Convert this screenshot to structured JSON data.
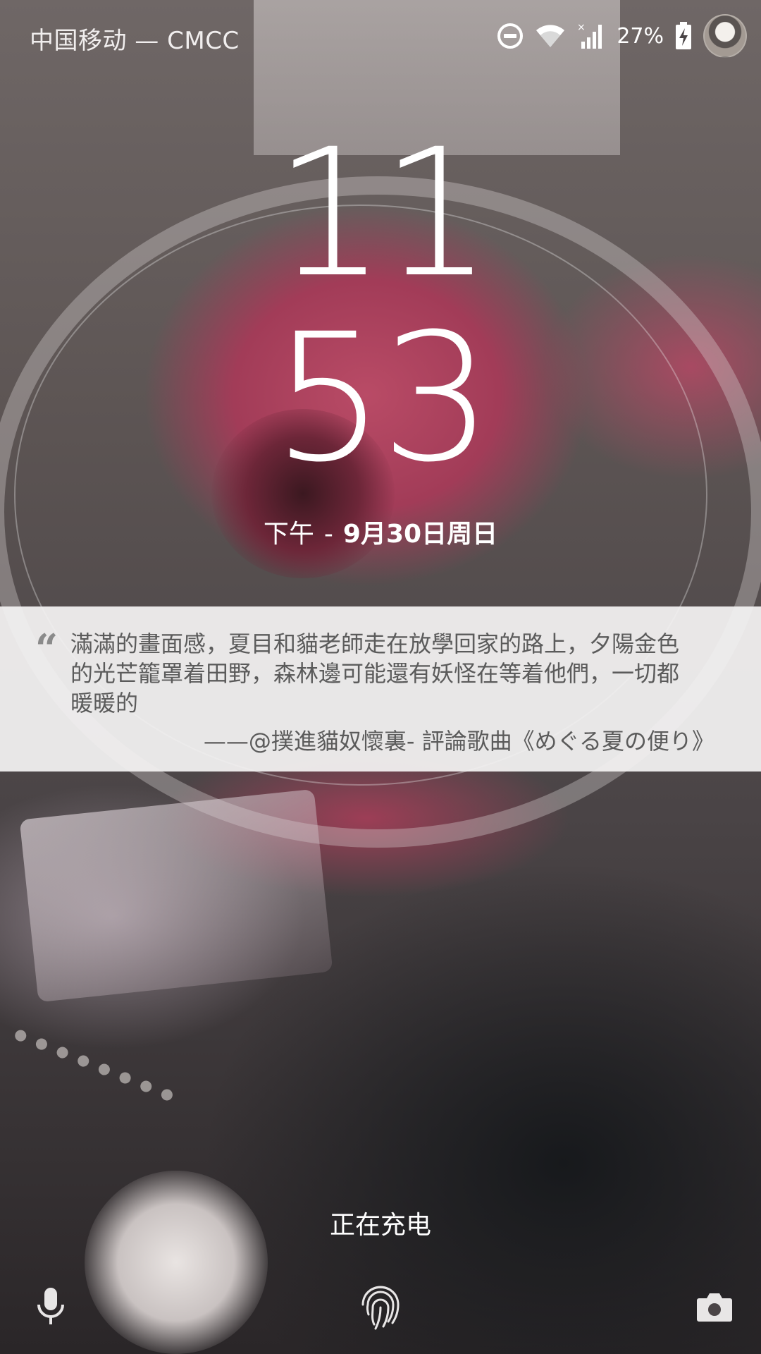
{
  "status_bar": {
    "carrier": "中国移动 — CMCC",
    "battery_percent": "27%",
    "icons": [
      "do-not-disturb-icon",
      "wifi-icon",
      "cellular-signal-icon",
      "battery-charging-icon",
      "avatar"
    ]
  },
  "clock": {
    "hour": "11",
    "minute": "53",
    "period": "下午",
    "separator": "-",
    "date": "9月30日周日"
  },
  "quote": {
    "text": "滿滿的畫面感，夏目和貓老師走在放學回家的路上，夕陽金色的光芒籠罩着田野，森林邊可能還有妖怪在等着他們，一切都暖暖的",
    "source": "——@撲進貓奴懷裏- 評論歌曲《めぐる夏の便り》"
  },
  "bottom": {
    "charging_text": "正在充电",
    "icons": [
      "microphone-icon",
      "fingerprint-icon",
      "camera-icon"
    ]
  },
  "colors": {
    "quote_background": "#f4f3f3",
    "quote_text": "#5b5b5b",
    "text_primary": "#ffffff"
  }
}
